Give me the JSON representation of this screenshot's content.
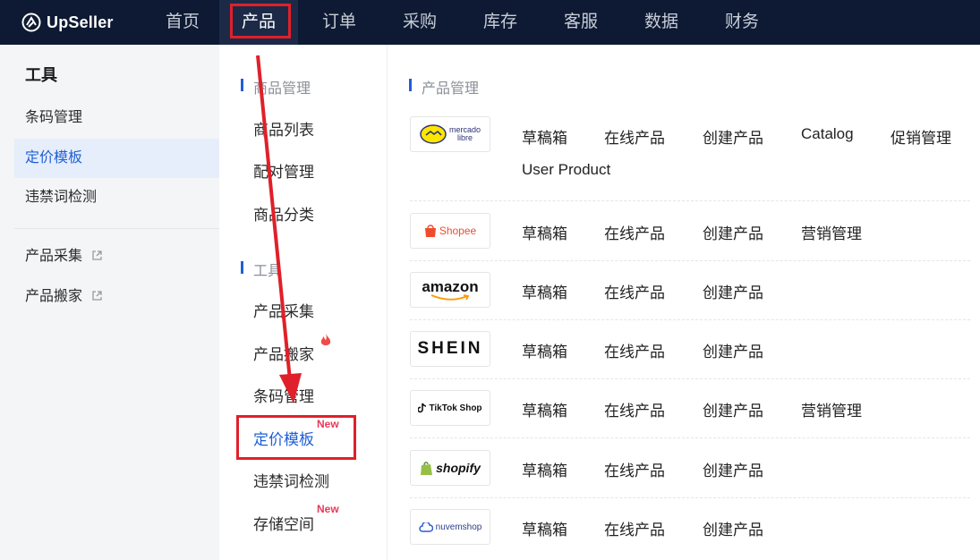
{
  "brand": {
    "name": "UpSeller"
  },
  "topnav": {
    "items": [
      {
        "label": "首页"
      },
      {
        "label": "产品",
        "active": true
      },
      {
        "label": "订单"
      },
      {
        "label": "采购"
      },
      {
        "label": "库存"
      },
      {
        "label": "客服"
      },
      {
        "label": "数据"
      },
      {
        "label": "财务"
      }
    ]
  },
  "left_panel": {
    "title": "工具",
    "items": [
      {
        "label": "条码管理"
      },
      {
        "label": "定价模板",
        "active": true
      },
      {
        "label": "违禁词检测"
      },
      {
        "label": "产品采集",
        "external": true
      },
      {
        "label": "产品搬家",
        "external": true
      }
    ]
  },
  "dropdown": {
    "goods_section": {
      "header": "商品管理",
      "items": [
        {
          "label": "商品列表"
        },
        {
          "label": "配对管理"
        },
        {
          "label": "商品分类"
        }
      ]
    },
    "tools_section": {
      "header": "工具",
      "items": [
        {
          "label": "产品采集"
        },
        {
          "label": "产品搬家",
          "hot": true
        },
        {
          "label": "条码管理"
        },
        {
          "label": "定价模板",
          "badge": "New",
          "active": true
        },
        {
          "label": "违禁词检测"
        },
        {
          "label": "存储空间",
          "badge": "New"
        }
      ]
    },
    "product_section": {
      "header": "产品管理",
      "platforms": [
        {
          "logo_text": [
            "mercado",
            "libre"
          ],
          "links": [
            "草稿箱",
            "在线产品",
            "创建产品",
            "Catalog",
            "促销管理",
            "User Product"
          ]
        },
        {
          "logo_text": "Shopee",
          "links": [
            "草稿箱",
            "在线产品",
            "创建产品",
            "营销管理"
          ]
        },
        {
          "logo_text": "amazon",
          "links": [
            "草稿箱",
            "在线产品",
            "创建产品"
          ]
        },
        {
          "logo_text": "SHEIN",
          "links": [
            "草稿箱",
            "在线产品",
            "创建产品"
          ]
        },
        {
          "logo_text": "TikTok Shop",
          "links": [
            "草稿箱",
            "在线产品",
            "创建产品",
            "营销管理"
          ]
        },
        {
          "logo_text": "shopify",
          "links": [
            "草稿箱",
            "在线产品",
            "创建产品"
          ]
        },
        {
          "logo_text": "nuvemshop",
          "links": [
            "草稿箱",
            "在线产品",
            "创建产品"
          ]
        }
      ]
    }
  },
  "colors": {
    "nav_bg": "#0e1a33",
    "accent": "#1f5fd6",
    "new_badge": "#e8395a",
    "annotation": "#e0202a"
  }
}
